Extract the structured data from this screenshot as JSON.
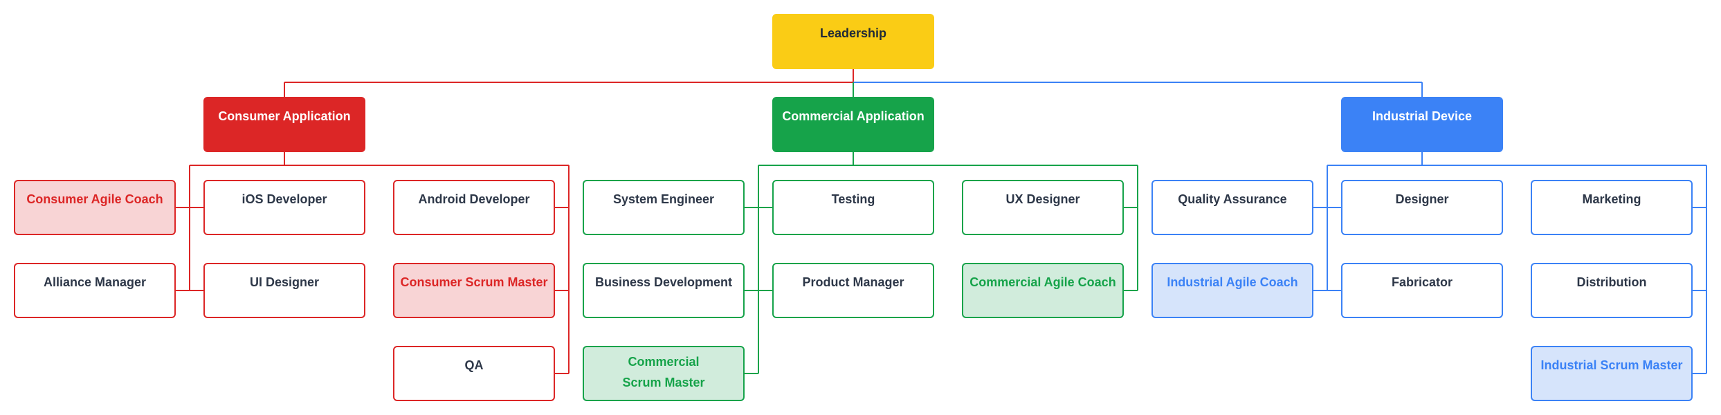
{
  "colors": {
    "leadership": "#facc15",
    "leadership_text": "#1f2937",
    "consumer": "#dc2626",
    "consumer_light": "#f8d4d5",
    "commercial": "#16a34a",
    "commercial_light": "#d1ecdc",
    "industrial": "#3b82f6",
    "industrial_light": "#d6e4fb",
    "member_text": "#2d3748"
  },
  "root": {
    "label": "Leadership"
  },
  "divisions": [
    {
      "key": "consumer",
      "label": "Consumer Application",
      "members": [
        {
          "label": "Consumer Agile Coach",
          "highlight": true
        },
        {
          "label": "iOS Developer",
          "highlight": false
        },
        {
          "label": "Android Developer",
          "highlight": false
        },
        {
          "label": "Alliance Manager",
          "highlight": false
        },
        {
          "label": "UI Designer",
          "highlight": false
        },
        {
          "label": "Consumer Scrum Master",
          "highlight": true
        },
        {
          "label": "QA",
          "highlight": false
        }
      ]
    },
    {
      "key": "commercial",
      "label": "Commercial Application",
      "members": [
        {
          "label": "System Engineer",
          "highlight": false
        },
        {
          "label": "Testing",
          "highlight": false
        },
        {
          "label": "UX Designer",
          "highlight": false
        },
        {
          "label": "Business Development",
          "highlight": false
        },
        {
          "label": "Product Manager",
          "highlight": false
        },
        {
          "label": "Commercial Agile Coach",
          "highlight": true
        },
        {
          "label": "Commercial\nScrum Master",
          "highlight": true
        }
      ]
    },
    {
      "key": "industrial",
      "label": "Industrial Device",
      "members": [
        {
          "label": "Quality Assurance",
          "highlight": false
        },
        {
          "label": "Designer",
          "highlight": false
        },
        {
          "label": "Marketing",
          "highlight": false
        },
        {
          "label": "Industrial Agile Coach",
          "highlight": true
        },
        {
          "label": "Fabricator",
          "highlight": false
        },
        {
          "label": "Distribution",
          "highlight": false
        },
        {
          "label": "Industrial Scrum Master",
          "highlight": true
        }
      ]
    }
  ]
}
